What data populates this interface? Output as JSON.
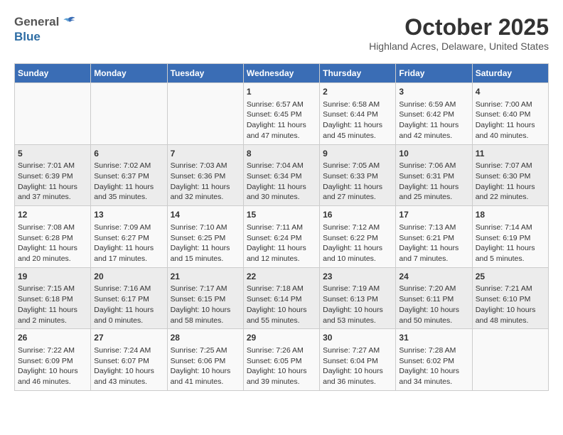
{
  "header": {
    "logo_general": "General",
    "logo_blue": "Blue",
    "month_title": "October 2025",
    "location": "Highland Acres, Delaware, United States"
  },
  "weekdays": [
    "Sunday",
    "Monday",
    "Tuesday",
    "Wednesday",
    "Thursday",
    "Friday",
    "Saturday"
  ],
  "weeks": [
    [
      {
        "day": "",
        "content": ""
      },
      {
        "day": "",
        "content": ""
      },
      {
        "day": "",
        "content": ""
      },
      {
        "day": "1",
        "content": "Sunrise: 6:57 AM\nSunset: 6:45 PM\nDaylight: 11 hours\nand 47 minutes."
      },
      {
        "day": "2",
        "content": "Sunrise: 6:58 AM\nSunset: 6:44 PM\nDaylight: 11 hours\nand 45 minutes."
      },
      {
        "day": "3",
        "content": "Sunrise: 6:59 AM\nSunset: 6:42 PM\nDaylight: 11 hours\nand 42 minutes."
      },
      {
        "day": "4",
        "content": "Sunrise: 7:00 AM\nSunset: 6:40 PM\nDaylight: 11 hours\nand 40 minutes."
      }
    ],
    [
      {
        "day": "5",
        "content": "Sunrise: 7:01 AM\nSunset: 6:39 PM\nDaylight: 11 hours\nand 37 minutes."
      },
      {
        "day": "6",
        "content": "Sunrise: 7:02 AM\nSunset: 6:37 PM\nDaylight: 11 hours\nand 35 minutes."
      },
      {
        "day": "7",
        "content": "Sunrise: 7:03 AM\nSunset: 6:36 PM\nDaylight: 11 hours\nand 32 minutes."
      },
      {
        "day": "8",
        "content": "Sunrise: 7:04 AM\nSunset: 6:34 PM\nDaylight: 11 hours\nand 30 minutes."
      },
      {
        "day": "9",
        "content": "Sunrise: 7:05 AM\nSunset: 6:33 PM\nDaylight: 11 hours\nand 27 minutes."
      },
      {
        "day": "10",
        "content": "Sunrise: 7:06 AM\nSunset: 6:31 PM\nDaylight: 11 hours\nand 25 minutes."
      },
      {
        "day": "11",
        "content": "Sunrise: 7:07 AM\nSunset: 6:30 PM\nDaylight: 11 hours\nand 22 minutes."
      }
    ],
    [
      {
        "day": "12",
        "content": "Sunrise: 7:08 AM\nSunset: 6:28 PM\nDaylight: 11 hours\nand 20 minutes."
      },
      {
        "day": "13",
        "content": "Sunrise: 7:09 AM\nSunset: 6:27 PM\nDaylight: 11 hours\nand 17 minutes."
      },
      {
        "day": "14",
        "content": "Sunrise: 7:10 AM\nSunset: 6:25 PM\nDaylight: 11 hours\nand 15 minutes."
      },
      {
        "day": "15",
        "content": "Sunrise: 7:11 AM\nSunset: 6:24 PM\nDaylight: 11 hours\nand 12 minutes."
      },
      {
        "day": "16",
        "content": "Sunrise: 7:12 AM\nSunset: 6:22 PM\nDaylight: 11 hours\nand 10 minutes."
      },
      {
        "day": "17",
        "content": "Sunrise: 7:13 AM\nSunset: 6:21 PM\nDaylight: 11 hours\nand 7 minutes."
      },
      {
        "day": "18",
        "content": "Sunrise: 7:14 AM\nSunset: 6:19 PM\nDaylight: 11 hours\nand 5 minutes."
      }
    ],
    [
      {
        "day": "19",
        "content": "Sunrise: 7:15 AM\nSunset: 6:18 PM\nDaylight: 11 hours\nand 2 minutes."
      },
      {
        "day": "20",
        "content": "Sunrise: 7:16 AM\nSunset: 6:17 PM\nDaylight: 11 hours\nand 0 minutes."
      },
      {
        "day": "21",
        "content": "Sunrise: 7:17 AM\nSunset: 6:15 PM\nDaylight: 10 hours\nand 58 minutes."
      },
      {
        "day": "22",
        "content": "Sunrise: 7:18 AM\nSunset: 6:14 PM\nDaylight: 10 hours\nand 55 minutes."
      },
      {
        "day": "23",
        "content": "Sunrise: 7:19 AM\nSunset: 6:13 PM\nDaylight: 10 hours\nand 53 minutes."
      },
      {
        "day": "24",
        "content": "Sunrise: 7:20 AM\nSunset: 6:11 PM\nDaylight: 10 hours\nand 50 minutes."
      },
      {
        "day": "25",
        "content": "Sunrise: 7:21 AM\nSunset: 6:10 PM\nDaylight: 10 hours\nand 48 minutes."
      }
    ],
    [
      {
        "day": "26",
        "content": "Sunrise: 7:22 AM\nSunset: 6:09 PM\nDaylight: 10 hours\nand 46 minutes."
      },
      {
        "day": "27",
        "content": "Sunrise: 7:24 AM\nSunset: 6:07 PM\nDaylight: 10 hours\nand 43 minutes."
      },
      {
        "day": "28",
        "content": "Sunrise: 7:25 AM\nSunset: 6:06 PM\nDaylight: 10 hours\nand 41 minutes."
      },
      {
        "day": "29",
        "content": "Sunrise: 7:26 AM\nSunset: 6:05 PM\nDaylight: 10 hours\nand 39 minutes."
      },
      {
        "day": "30",
        "content": "Sunrise: 7:27 AM\nSunset: 6:04 PM\nDaylight: 10 hours\nand 36 minutes."
      },
      {
        "day": "31",
        "content": "Sunrise: 7:28 AM\nSunset: 6:02 PM\nDaylight: 10 hours\nand 34 minutes."
      },
      {
        "day": "",
        "content": ""
      }
    ]
  ]
}
